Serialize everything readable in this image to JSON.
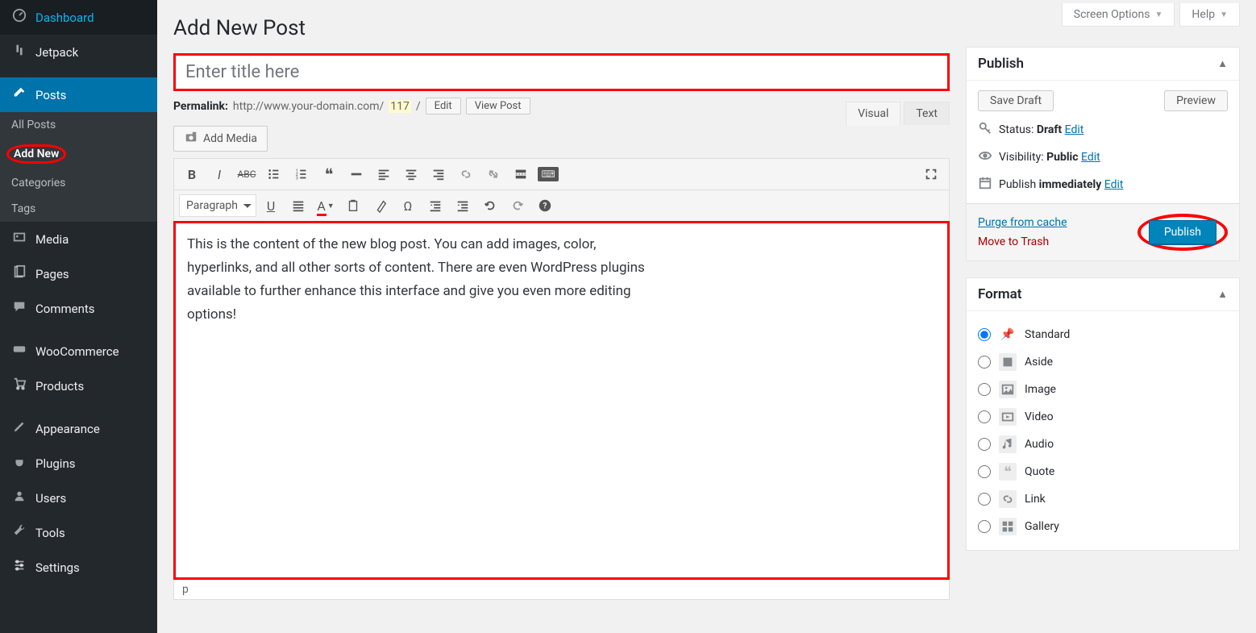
{
  "top": {
    "screen_options": "Screen Options",
    "help": "Help"
  },
  "sidebar": {
    "items": [
      {
        "label": "Dashboard"
      },
      {
        "label": "Jetpack"
      },
      {
        "label": "Posts"
      },
      {
        "label": "Media"
      },
      {
        "label": "Pages"
      },
      {
        "label": "Comments"
      },
      {
        "label": "WooCommerce"
      },
      {
        "label": "Products"
      },
      {
        "label": "Appearance"
      },
      {
        "label": "Plugins"
      },
      {
        "label": "Users"
      },
      {
        "label": "Tools"
      },
      {
        "label": "Settings"
      }
    ],
    "posts_sub": [
      "All Posts",
      "Add New",
      "Categories",
      "Tags"
    ]
  },
  "page": {
    "title": "Add New Post",
    "title_placeholder": "Enter title here",
    "permalink_label": "Permalink:",
    "permalink_base": "http://www.your-domain.com/",
    "permalink_slug": "117",
    "permalink_trail": "/",
    "edit_btn": "Edit",
    "view_post_btn": "View Post",
    "add_media": "Add Media",
    "editor_tabs": {
      "visual": "Visual",
      "text": "Text"
    },
    "format_select": "Paragraph",
    "content": "This is the content of the new blog post. You can add images, color, hyperlinks, and all other sorts of content. There are even WordPress plugins available to further enhance this interface and give you even more editing options!",
    "path": "p"
  },
  "publish": {
    "title": "Publish",
    "save_draft": "Save Draft",
    "preview": "Preview",
    "status_label": "Status:",
    "status_value": "Draft",
    "visibility_label": "Visibility:",
    "visibility_value": "Public",
    "schedule_label": "Publish",
    "schedule_value": "immediately",
    "edit": "Edit",
    "purge": "Purge from cache",
    "trash": "Move to Trash",
    "publish_btn": "Publish"
  },
  "format": {
    "title": "Format",
    "options": [
      "Standard",
      "Aside",
      "Image",
      "Video",
      "Audio",
      "Quote",
      "Link",
      "Gallery"
    ],
    "selected": 0
  }
}
